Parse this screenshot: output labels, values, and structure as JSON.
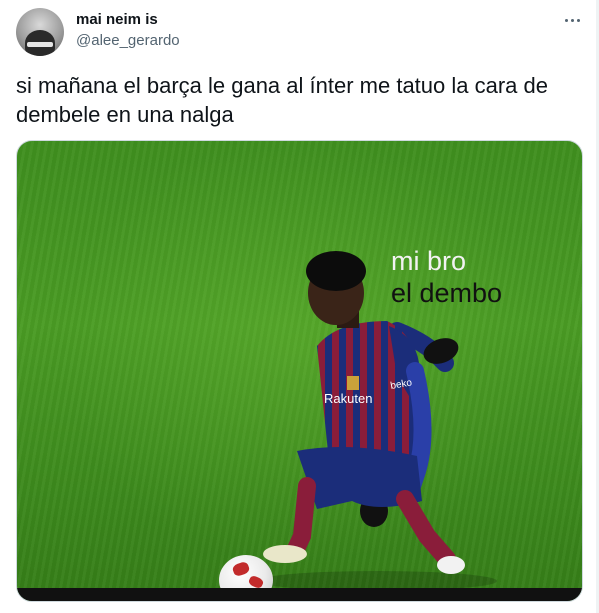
{
  "tweet": {
    "author": {
      "display_name": "mai neim is",
      "handle": "@alee_gerardo"
    },
    "text_line1": "si mañana el barça le gana al ínter me tatuo la cara de",
    "text_line2": "dembele en una nalga",
    "more_icon": "more-horizontal-icon"
  },
  "media": {
    "caption_line1": "mi bro",
    "caption_line2": "el dembo",
    "jersey_sponsor": "Rakuten",
    "sleeve_sponsor": "beko",
    "colors": {
      "pitch": "#4a9c24",
      "jersey_blue": "#1b2d7a",
      "jersey_red": "#8a1d3a"
    }
  }
}
